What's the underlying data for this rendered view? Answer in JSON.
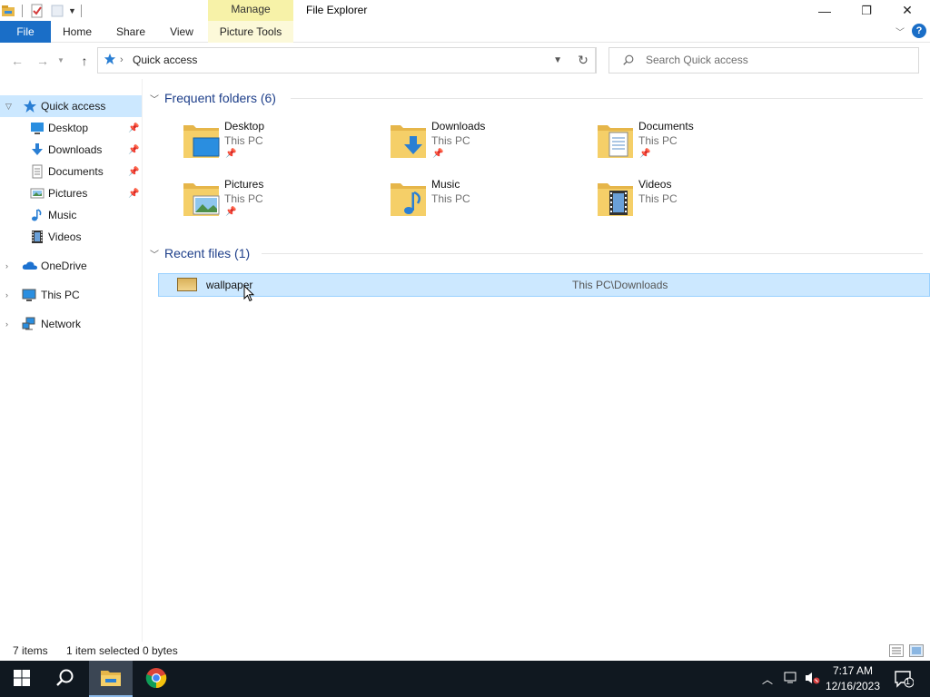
{
  "window": {
    "title": "File Explorer",
    "context_tab_group": "Manage",
    "minimize_glyph": "—",
    "restore_glyph": "❐",
    "close_glyph": "✕"
  },
  "ribbon": {
    "tabs": [
      "File",
      "Home",
      "Share",
      "View",
      "Picture Tools"
    ],
    "help_glyph": "?",
    "accent_color": "#1a6ec7"
  },
  "address": {
    "path": "Quick access",
    "search_placeholder": "Search Quick access"
  },
  "nav_pane": {
    "items": [
      {
        "label": "Quick access",
        "icon": "star-icon"
      },
      {
        "label": "Desktop",
        "icon": "desktop-icon",
        "pinned": true
      },
      {
        "label": "Downloads",
        "icon": "download-arrow-icon",
        "pinned": true
      },
      {
        "label": "Documents",
        "icon": "document-icon",
        "pinned": true
      },
      {
        "label": "Pictures",
        "icon": "picture-icon",
        "pinned": true
      },
      {
        "label": "Music",
        "icon": "music-note-icon"
      },
      {
        "label": "Videos",
        "icon": "film-icon"
      },
      {
        "label": "OneDrive",
        "icon": "cloud-icon"
      },
      {
        "label": "This PC",
        "icon": "computer-icon"
      },
      {
        "label": "Network",
        "icon": "network-icon"
      }
    ]
  },
  "content": {
    "frequent_header": "Frequent folders (6)",
    "recent_header": "Recent files (1)",
    "folders": [
      {
        "name": "Desktop",
        "location": "This PC",
        "pinned": true,
        "icon": "desktop-folder-icon"
      },
      {
        "name": "Downloads",
        "location": "This PC",
        "pinned": true,
        "icon": "downloads-folder-icon"
      },
      {
        "name": "Documents",
        "location": "This PC",
        "pinned": true,
        "icon": "documents-folder-icon"
      },
      {
        "name": "Pictures",
        "location": "This PC",
        "pinned": true,
        "icon": "pictures-folder-icon"
      },
      {
        "name": "Music",
        "location": "This PC",
        "pinned": false,
        "icon": "music-folder-icon"
      },
      {
        "name": "Videos",
        "location": "This PC",
        "pinned": false,
        "icon": "videos-folder-icon"
      }
    ],
    "recent_files": [
      {
        "name": "wallpaper",
        "path": "This PC\\Downloads",
        "selected": true,
        "icon": "image-file-icon"
      }
    ]
  },
  "status": {
    "item_count": "7 items",
    "selection": "1 item selected",
    "size": "0 bytes"
  },
  "taskbar": {
    "time": "7:17 AM",
    "date": "12/16/2023",
    "notification_count": "1",
    "apps": [
      "start-icon",
      "search-icon",
      "file-explorer-icon",
      "chrome-icon"
    ]
  }
}
